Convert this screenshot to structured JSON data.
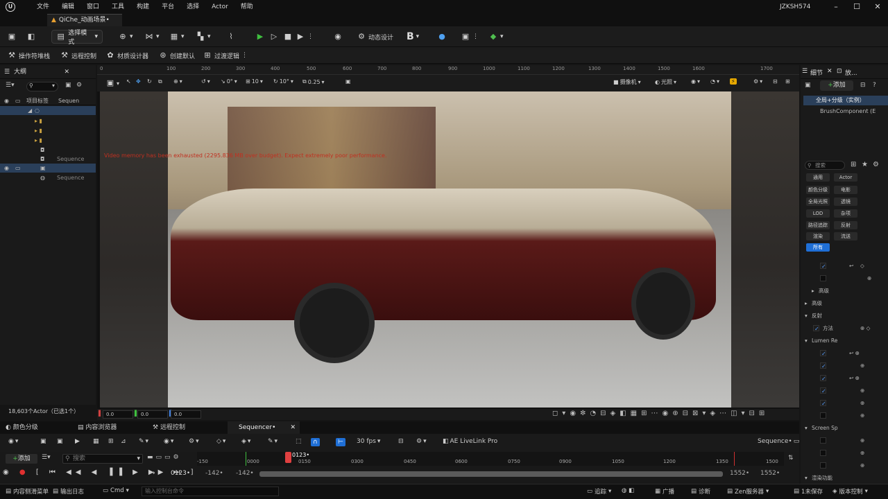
{
  "titlebar": {
    "menu": [
      "文件",
      "编辑",
      "窗口",
      "工具",
      "构建",
      "平台",
      "选择",
      "Actor",
      "帮助"
    ],
    "user": "JZKSH574",
    "level_tab": "QiChe_动画场景•"
  },
  "toolbar": {
    "select_mode": "选择模式",
    "dynamic_design": "动态设计"
  },
  "toolbar2": {
    "items": [
      "操作符堆栈",
      "远程控制",
      "材质设计器",
      "创建默认",
      "过渡逻辑"
    ]
  },
  "outliner": {
    "title": "大纲",
    "col_label": "项目标签",
    "col_sequence": "Sequen",
    "row_sequence": "Sequence",
    "row_sequence2": "Sequence",
    "actor_count": "18,603个Actor（已选1个）"
  },
  "ruler": {
    "ticks": [
      "0",
      "100",
      "200",
      "300",
      "400",
      "500",
      "600",
      "700",
      "800",
      "900",
      "1000",
      "1100",
      "1200",
      "1300",
      "1400",
      "1500",
      "1600",
      "1700"
    ]
  },
  "viewport": {
    "angle": "0°",
    "grid": "10",
    "rot": "10°",
    "scale": "0.25",
    "camera": "摄像机",
    "lit": "光照",
    "warning": "Video memory has been exhausted (2295.836 MB over budget). Expect extremely poor performance.",
    "coord_x": "0.0",
    "coord_y": "0.0",
    "coord_z": "0.0"
  },
  "details": {
    "tab1": "细节",
    "tab2": "放...",
    "add": "添加",
    "root": "全局+分级（实例）",
    "component": "BrushComponent (E",
    "search": "搜索",
    "categories": [
      "通用",
      "Actor",
      "颜色分级",
      "电影",
      "全局光照",
      "透镜",
      "LOD",
      "杂项",
      "路径追踪",
      "反射",
      "渲染",
      "流送",
      "所有"
    ],
    "section_advanced": "高级",
    "section_advanced2": "高级",
    "section_reflection": "反射",
    "reflection_method": "方法",
    "section_lumen": "Lumen Re",
    "section_screen": "Screen Sp",
    "section_render": "渲染功能"
  },
  "bottom_tabs": [
    "颜色分级",
    "内容浏览器",
    "远程控制",
    "Sequencer•"
  ],
  "sequencer": {
    "add": "添加",
    "search": "搜索",
    "fps": "30 fps",
    "livelink": "AE LiveLink Pro",
    "sequence_name": "Sequence•",
    "current_frame": "0123•",
    "playhead": "0123•",
    "start": "-142•",
    "end": "-142•",
    "range_end": "1552•",
    "range_end2": "1552•"
  },
  "timeline": {
    "labels": [
      "-150",
      "0000",
      "0150",
      "0300",
      "0450",
      "0600",
      "0750",
      "0900",
      "1050",
      "1200",
      "1350",
      "1500"
    ]
  },
  "status": {
    "drawer": "内容侧滑菜单",
    "log": "输出日志",
    "cmd": "Cmd",
    "cmd_placeholder": "输入控制台命令",
    "trace": "追踪",
    "broadcast": "广播",
    "diag": "诊断",
    "zen": "Zen服务器",
    "unsaved": "1未保存",
    "version": "版本控制"
  }
}
